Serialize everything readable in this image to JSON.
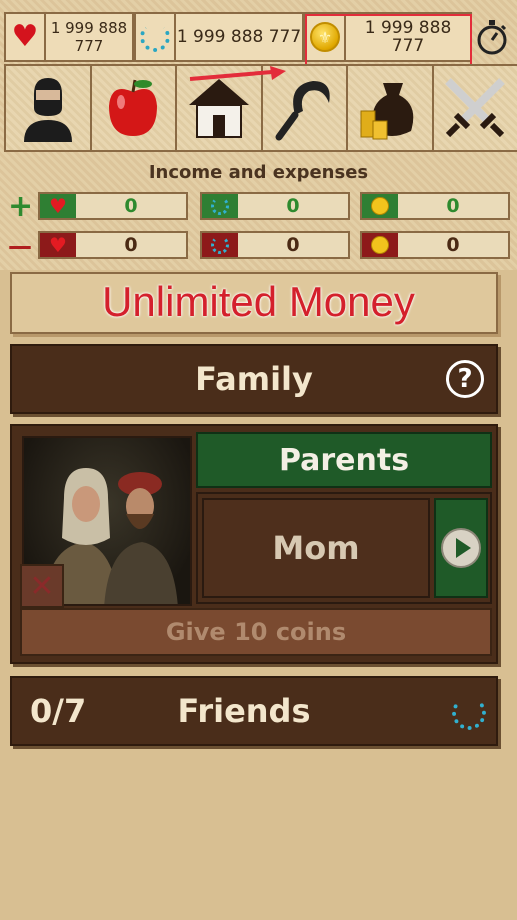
{
  "stats": {
    "health_value": "1 999 888 777",
    "fame_value": "1 999 888 777",
    "gold_value": "1 999 888 777"
  },
  "menu": {
    "items": [
      "character-icon",
      "apple-icon",
      "house-icon",
      "sickle-icon",
      "money-bag-icon",
      "crossed-swords-icon"
    ]
  },
  "income": {
    "title": "Income and expenses",
    "plus_sign": "+",
    "minus_sign": "—",
    "plus": [
      "0",
      "0",
      "0"
    ],
    "minus": [
      "0",
      "0",
      "0"
    ]
  },
  "overlay": {
    "text": "Unlimited Money"
  },
  "family": {
    "title": "Family",
    "help": "?",
    "parents_label": "Parents",
    "selected_parent": "Mom",
    "give_button": "Give 10 coins",
    "close": "✕"
  },
  "friends": {
    "count": "0/7",
    "title": "Friends"
  },
  "colors": {
    "accent_red": "#e32c3a",
    "green": "#1f5a28",
    "brown_panel": "#4a2d1a"
  }
}
